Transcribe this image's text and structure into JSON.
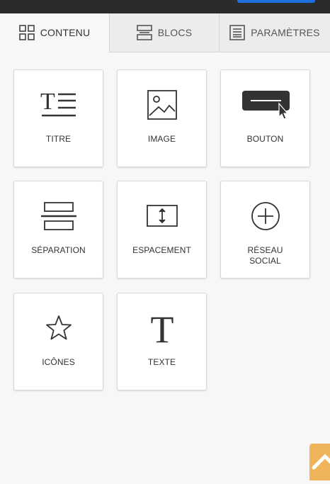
{
  "tabs": [
    {
      "label": "CONTENU",
      "icon": "grid-icon"
    },
    {
      "label": "BLOCS",
      "icon": "blocks-icon"
    },
    {
      "label": "PARAMÈTRES",
      "icon": "settings-doc-icon"
    }
  ],
  "tiles": [
    {
      "label": "TITRE",
      "icon": "title-icon"
    },
    {
      "label": "IMAGE",
      "icon": "image-icon"
    },
    {
      "label": "BOUTON",
      "icon": "button-icon"
    },
    {
      "label": "SÉPARATION",
      "icon": "divider-icon"
    },
    {
      "label": "ESPACEMENT",
      "icon": "spacer-icon"
    },
    {
      "label": "RÉSEAU\nSOCIAL",
      "icon": "social-plus-icon"
    },
    {
      "label": "ICÔNES",
      "icon": "star-icon"
    },
    {
      "label": "TEXTE",
      "icon": "text-icon"
    }
  ],
  "colors": {
    "topbar": "#2b2b2b",
    "accent_button": "#1f6fe0",
    "scroll_top": "#f0b55a"
  }
}
